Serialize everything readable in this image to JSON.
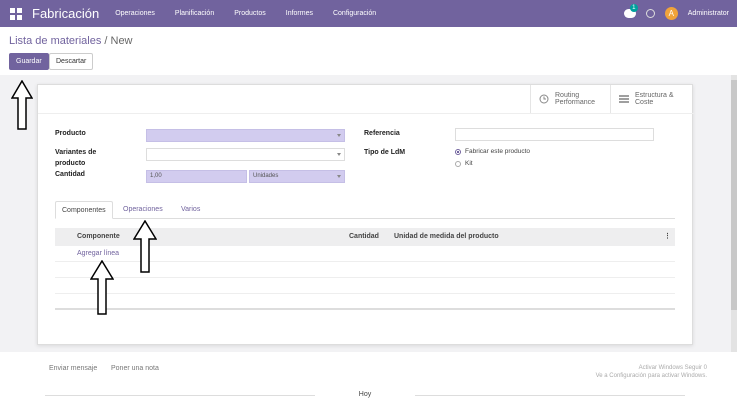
{
  "topbar": {
    "brand": "Fabricación",
    "menu": [
      "Operaciones",
      "Planificación",
      "Productos",
      "Informes",
      "Configuración"
    ],
    "chat_badge": "1",
    "user_initial": "A",
    "user_name": "Administrator"
  },
  "breadcrumb": {
    "parent": "Lista de materiales",
    "current": "New"
  },
  "buttons": {
    "save": "Guardar",
    "discard": "Descartar"
  },
  "smart_buttons": {
    "routing_line1": "Routing",
    "routing_line2": "Performance",
    "estructura_line1": "Estructura &",
    "estructura_line2": "Coste"
  },
  "form": {
    "producto_label": "Producto",
    "variantes_label_1": "Variantes de",
    "variantes_label_2": "producto",
    "cantidad_label": "Cantidad",
    "cantidad_value": "1,00",
    "unidad_value": "Unidades",
    "referencia_label": "Referencia",
    "tipo_label": "Tipo de LdM",
    "tipo_opt1": "Fabricar este producto",
    "tipo_opt2": "Kit"
  },
  "tabs": [
    "Componentes",
    "Operaciones",
    "Varios"
  ],
  "grid": {
    "col_componente": "Componente",
    "col_cantidad": "Cantidad",
    "col_unidad": "Unidad de medida del producto",
    "add_line": "Agregar línea"
  },
  "chatter": {
    "send_message": "Enviar mensaje",
    "log_note": "Poner una nota",
    "watermark_1": "Activar Windows  Seguir  0",
    "watermark_2": "Ve a Configuración para activar Windows.",
    "today": "Hoy"
  },
  "colors": {
    "brand": "#71639e",
    "required_field": "#d2ccef",
    "badge": "#00a09d",
    "avatar": "#f0a33a"
  }
}
